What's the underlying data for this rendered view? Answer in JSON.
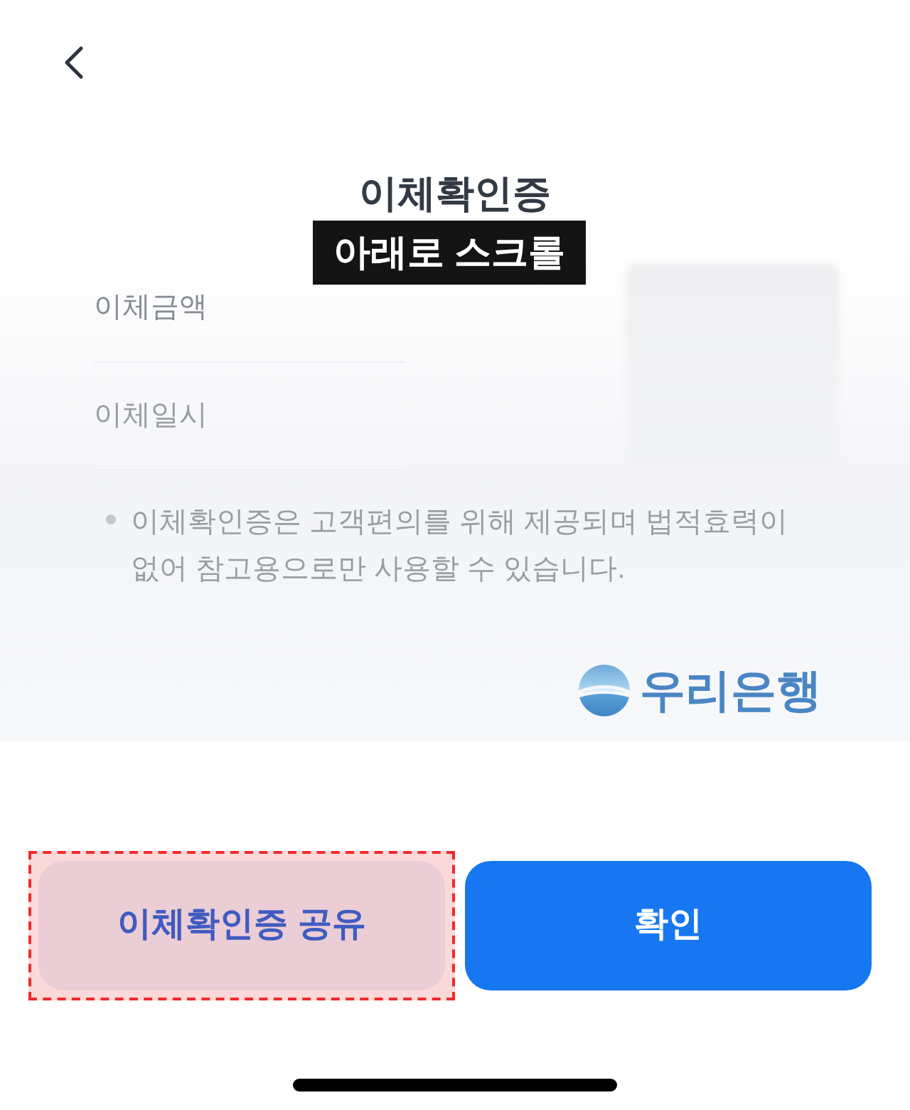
{
  "title": "이체확인증",
  "annotation": {
    "text": "아래로 스크롤"
  },
  "details": [
    {
      "label": "이체금액"
    },
    {
      "label": "이체일시"
    }
  ],
  "notice": "이체확인증은 고객편의를 위해 제공되며 법적효력이 없어 참고용으로만 사용할 수 있습니다.",
  "bank_logo": {
    "name": "우리은행"
  },
  "buttons": [
    {
      "label": "이체확인증 공유",
      "kind": "secondary",
      "highlighted": true
    },
    {
      "label": "확인",
      "kind": "primary",
      "highlighted": false
    }
  ]
}
